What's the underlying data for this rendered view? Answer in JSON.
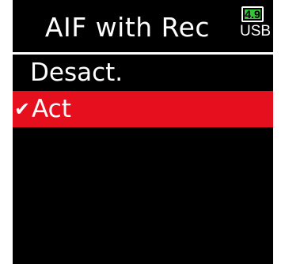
{
  "header": {
    "title": "AIF with Rec",
    "battery": {
      "value": "4.9",
      "source": "USB",
      "level_color": "#36c53a"
    }
  },
  "options": [
    {
      "label": "Desact.",
      "selected": false
    },
    {
      "label": "Act",
      "selected": true
    }
  ],
  "check_mark": "✔",
  "colors": {
    "background": "#000000",
    "selected_row": "#e60f1e",
    "text": "#ffffff"
  }
}
